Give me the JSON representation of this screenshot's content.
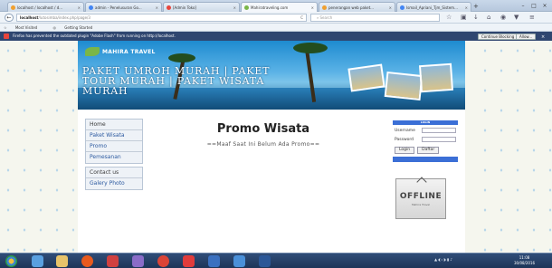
{
  "browser": {
    "tabs": [
      {
        "label": "localhost / localhost / d...",
        "color": "#f0a030"
      },
      {
        "label": "admin - Penelusuran Go...",
        "color": "#4285f4"
      },
      {
        "label": "[Admin Toko]",
        "color": "#e8453c"
      },
      {
        "label": "Mahiratraveling.com",
        "color": "#7ab648",
        "active": true
      },
      {
        "label": "penerangan web paket...",
        "color": "#f0a030"
      },
      {
        "label": "Ismail_Apriani_Tjm_Sistem...",
        "color": "#4285f4"
      }
    ],
    "new_tab": "+",
    "url_host": "localhost",
    "url_path": "/lutosimba/index.php/page/3",
    "url_reload": "C",
    "search_placeholder": "Search",
    "bookmarks": [
      "Most Visited",
      "Getting Started"
    ],
    "plugin_message": "Firefox has prevented the outdated plugin \"Adobe Flash\" from running on http://localhost.",
    "continue_blocking": "Continue Blocking",
    "allow": "Allow..."
  },
  "site": {
    "logo_text": "MAHIRA TRAVEL",
    "banner_title": "PAKET UMROH MURAH | PAKET TOUR MURAH | PAKET WISATA MURAH",
    "menu_group1": [
      "Home",
      "Paket Wisata",
      "Promo",
      "Pemesanan"
    ],
    "menu_group2": [
      "Contact us",
      "Galery Photo"
    ],
    "content_title": "Promo Wisata",
    "content_message": "==Maaf Saat Ini Belum Ada Promo==",
    "login": {
      "header": "LOGIN",
      "username_label": "Username",
      "password_label": "Password",
      "login_button": "Login",
      "register_button": "Daftar"
    },
    "offline_sign": "OFFLINE",
    "offline_sub": "Mahira Travel"
  },
  "taskbar": {
    "time": "11:08",
    "date": "30/08/2016"
  }
}
